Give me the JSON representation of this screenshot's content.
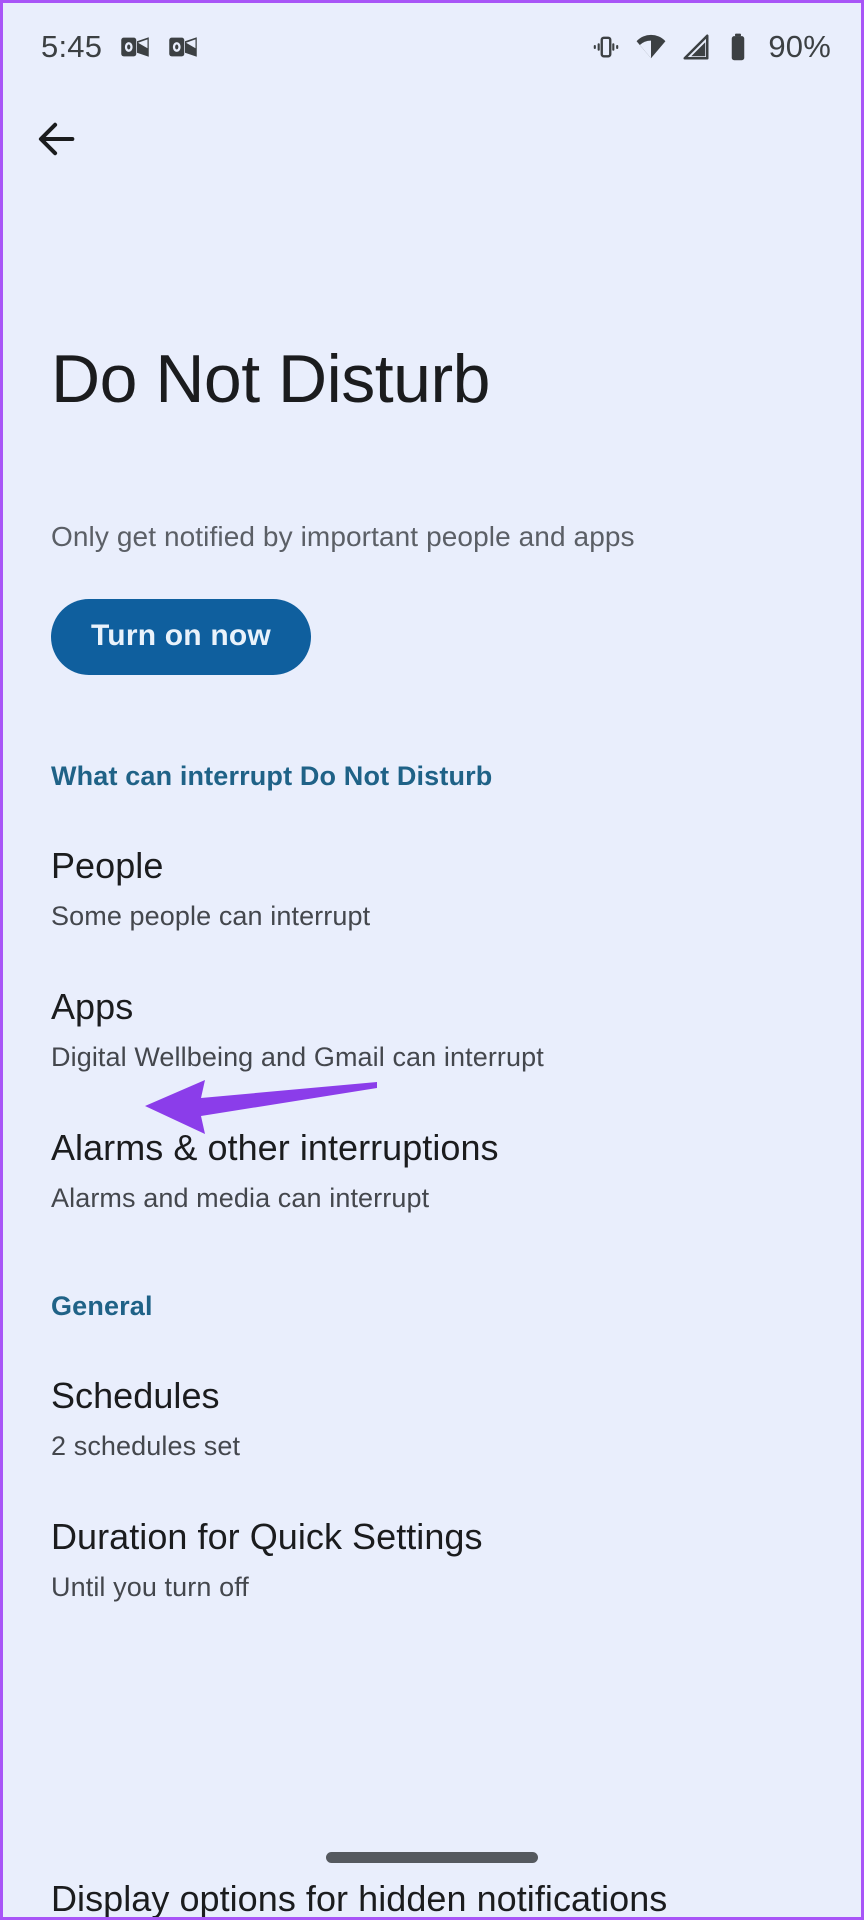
{
  "status_bar": {
    "time": "5:45",
    "notification_icons": [
      "outlook-icon",
      "outlook-icon"
    ],
    "right_icons": [
      "vibrate-icon",
      "wifi-icon",
      "cellular-signal-icon",
      "battery-icon"
    ],
    "battery_percent": "90%"
  },
  "nav": {
    "back_icon": "back-arrow-icon"
  },
  "page": {
    "title": "Do Not Disturb",
    "subtitle": "Only get notified by important people and apps",
    "primary_button": "Turn on now"
  },
  "sections": [
    {
      "header": "What can interrupt Do Not Disturb",
      "items": [
        {
          "title": "People",
          "subtitle": "Some people can interrupt"
        },
        {
          "title": "Apps",
          "subtitle": "Digital Wellbeing and Gmail can interrupt"
        },
        {
          "title": "Alarms & other interruptions",
          "subtitle": "Alarms and media can interrupt"
        }
      ]
    },
    {
      "header": "General",
      "items": [
        {
          "title": "Schedules",
          "subtitle": "2 schedules set"
        },
        {
          "title": "Duration for Quick Settings",
          "subtitle": "Until you turn off"
        }
      ]
    }
  ],
  "clipped_item": {
    "title": "Display options for hidden notifications"
  },
  "annotation": {
    "type": "arrow",
    "points_to": "Apps",
    "color": "#8b3dea"
  },
  "colors": {
    "background": "#e9eefc",
    "frame_border": "#a855f7",
    "accent_button": "#0f5f9e",
    "section_header": "#1f6287",
    "title_text": "#1b1c1e",
    "secondary_text": "#44474d",
    "gesture_bar": "#55595f"
  }
}
